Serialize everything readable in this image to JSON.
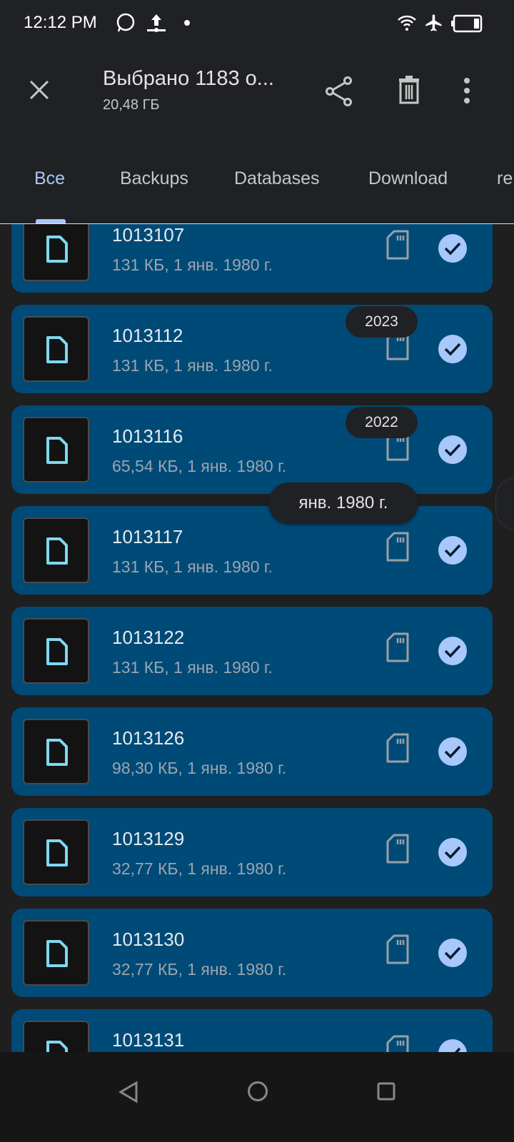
{
  "status_bar": {
    "time": "12:12 PM",
    "icons": [
      "whatsapp-icon",
      "upload-icon",
      "dot-icon",
      "wifi-icon",
      "airplane-icon",
      "battery-icon"
    ]
  },
  "header": {
    "title": "Выбрано 1183 о...",
    "subtitle": "20,48 ГБ",
    "actions": [
      "close-icon",
      "share-icon",
      "delete-icon",
      "more-icon"
    ]
  },
  "tabs": [
    {
      "label": "Все",
      "active": true
    },
    {
      "label": "Backups"
    },
    {
      "label": "Databases"
    },
    {
      "label": "Download"
    },
    {
      "label": "re"
    }
  ],
  "files": [
    {
      "name": "1013107",
      "meta": "131 КБ, 1 янв. 1980 г.",
      "selected": true
    },
    {
      "name": "1013112",
      "meta": "131 КБ, 1 янв. 1980 г.",
      "selected": true
    },
    {
      "name": "1013116",
      "meta": "65,54 КБ, 1 янв. 1980 г.",
      "selected": true
    },
    {
      "name": "1013117",
      "meta": "131 КБ, 1 янв. 1980 г.",
      "selected": true
    },
    {
      "name": "1013122",
      "meta": "131 КБ, 1 янв. 1980 г.",
      "selected": true
    },
    {
      "name": "1013126",
      "meta": "98,30 КБ, 1 янв. 1980 г.",
      "selected": true
    },
    {
      "name": "1013129",
      "meta": "32,77 КБ, 1 янв. 1980 г.",
      "selected": true
    },
    {
      "name": "1013130",
      "meta": "32,77 КБ, 1 янв. 1980 г.",
      "selected": true
    },
    {
      "name": "1013131",
      "meta": "",
      "selected": true
    }
  ],
  "scroll_labels": {
    "year1": "2023",
    "year2": "2022",
    "current": "янв. 1980 г."
  },
  "colors": {
    "card": "#004a77",
    "accent": "#a8c7fa",
    "file_icon": "#7fd8f0"
  }
}
